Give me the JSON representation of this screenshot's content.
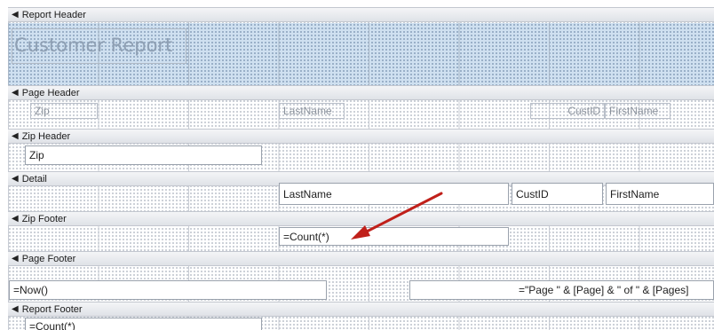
{
  "sections": {
    "report_header": "Report Header",
    "page_header": "Page Header",
    "zip_header": "Zip Header",
    "detail": "Detail",
    "zip_footer": "Zip Footer",
    "page_footer": "Page Footer",
    "report_footer": "Report Footer"
  },
  "report_header": {
    "title": "Customer Report"
  },
  "page_header": {
    "zip_label": "Zip",
    "lastname_label": "LastName",
    "custid_label": "CustID",
    "firstname_label": "FirstName"
  },
  "zip_header": {
    "zip_field": "Zip"
  },
  "detail": {
    "lastname_field": "LastName",
    "custid_field": "CustID",
    "firstname_field": "FirstName"
  },
  "zip_footer": {
    "count_field": "=Count(*)"
  },
  "page_footer": {
    "now_field": "=Now()",
    "page_field": "=\"Page \" & [Page] & \" of \" & [Pages]"
  },
  "report_footer": {
    "count_field": "=Count(*)"
  },
  "colors": {
    "section_bar": "#e6e8ec",
    "report_header_fill": "#cfe0f0",
    "arrow": "#c0201a"
  },
  "icons": {
    "section_arrow": "collapse-arrow-icon"
  }
}
